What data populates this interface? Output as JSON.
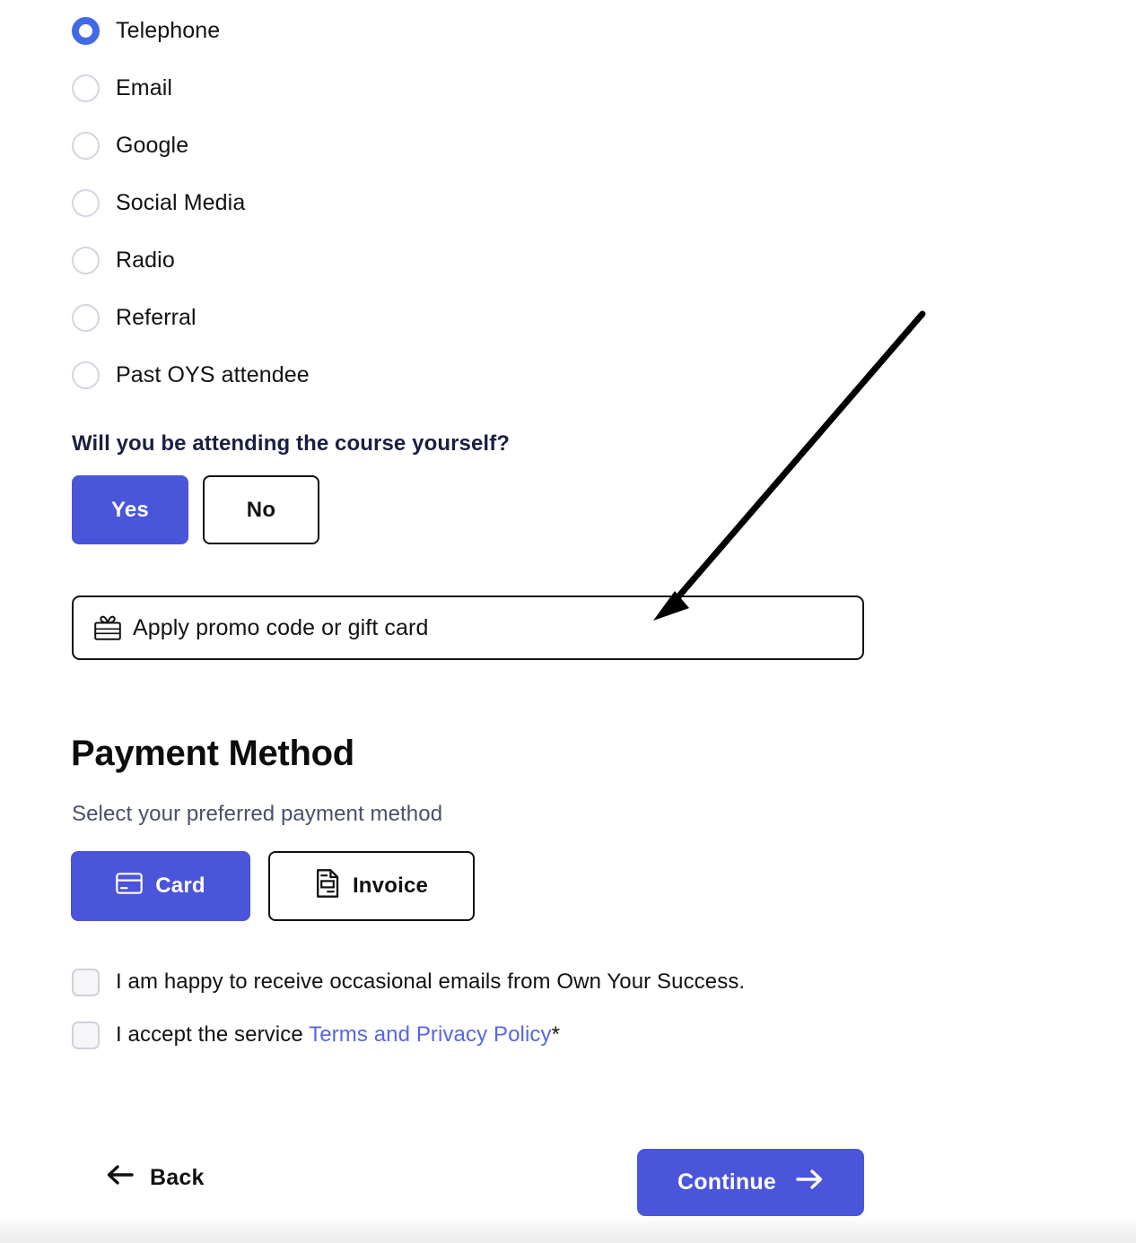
{
  "referral_source": {
    "options": [
      {
        "label": "Telephone",
        "selected": true
      },
      {
        "label": "Email",
        "selected": false
      },
      {
        "label": "Google",
        "selected": false
      },
      {
        "label": "Social Media",
        "selected": false
      },
      {
        "label": "Radio",
        "selected": false
      },
      {
        "label": "Referral",
        "selected": false
      },
      {
        "label": "Past OYS attendee",
        "selected": false
      }
    ]
  },
  "attendance": {
    "question": "Will you be attending the course yourself?",
    "yes_label": "Yes",
    "no_label": "No",
    "selected": "Yes"
  },
  "promo": {
    "label": "Apply promo code or gift card",
    "icon": "gift-card-icon"
  },
  "payment": {
    "title": "Payment Method",
    "subtitle": "Select your preferred payment method",
    "methods": [
      {
        "label": "Card",
        "icon": "credit-card-icon",
        "selected": true
      },
      {
        "label": "Invoice",
        "icon": "invoice-document-icon",
        "selected": false
      }
    ]
  },
  "consents": [
    {
      "text": "I am happy to receive occasional emails from Own Your Success.",
      "checked": false
    },
    {
      "text_before": "I accept the service ",
      "link_text": "Terms and Privacy Policy",
      "required_mark": "*",
      "checked": false
    }
  ],
  "footer": {
    "back_label": "Back",
    "back_icon": "arrow-left-icon",
    "continue_label": "Continue",
    "continue_icon": "arrow-right-icon"
  },
  "annotation": {
    "type": "pointer-arrow",
    "points_to": "promo-code-field"
  },
  "colors": {
    "primary_blue": "#4a55d9",
    "radio_blue": "#4169e8",
    "link_blue": "#5766e0",
    "heading_navy": "#1b1f42",
    "muted_slate": "#4a5068",
    "border_black": "#111111",
    "checkbox_border": "#cfd1da",
    "checkbox_fill": "#f6f6f9",
    "radio_border": "#d4d6e1"
  }
}
